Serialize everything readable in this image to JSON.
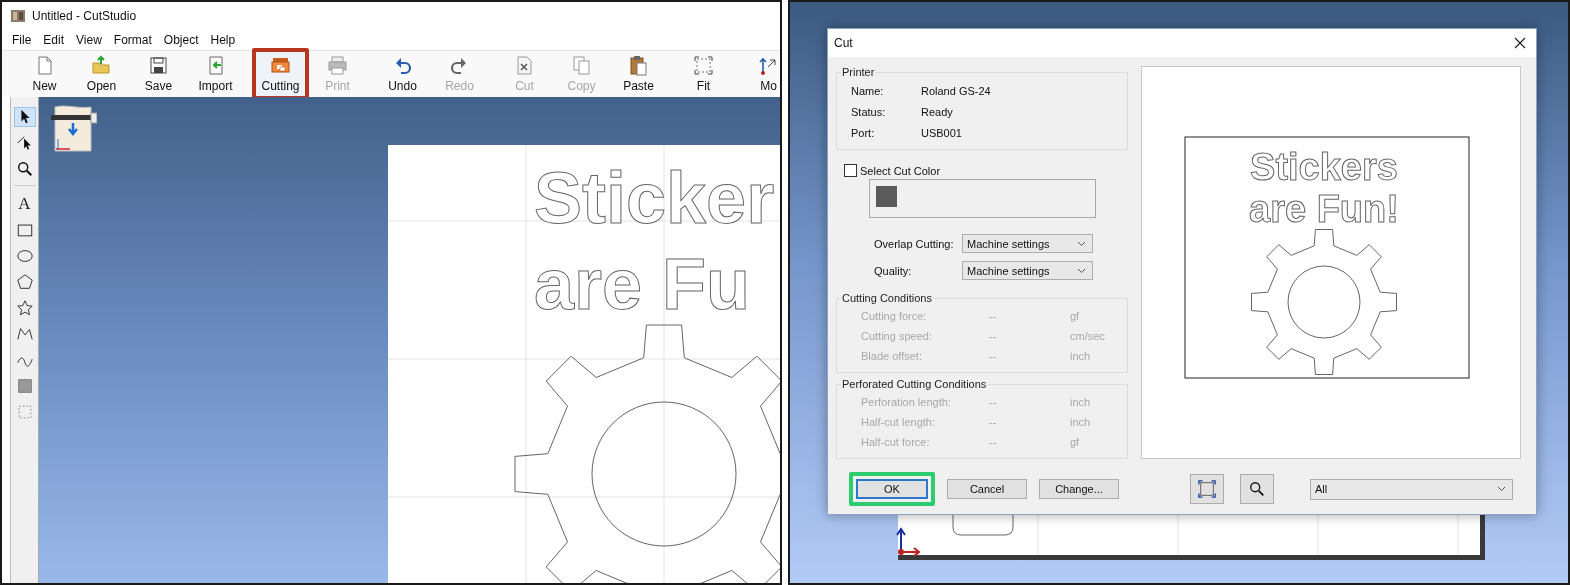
{
  "app_window": {
    "title": "Untitled - CutStudio",
    "menu": [
      "File",
      "Edit",
      "View",
      "Format",
      "Object",
      "Help"
    ],
    "toolbar_groups": [
      {
        "items": [
          {
            "kind": "new",
            "label": "New",
            "disabled": false,
            "highlighted": false
          },
          {
            "kind": "open",
            "label": "Open",
            "disabled": false,
            "highlighted": false
          },
          {
            "kind": "save",
            "label": "Save",
            "disabled": false,
            "highlighted": false
          },
          {
            "kind": "import",
            "label": "Import",
            "disabled": false,
            "highlighted": false
          }
        ]
      },
      {
        "items": [
          {
            "kind": "cutting",
            "label": "Cutting",
            "disabled": false,
            "highlighted": true
          },
          {
            "kind": "print",
            "label": "Print",
            "disabled": true,
            "highlighted": false
          }
        ]
      },
      {
        "items": [
          {
            "kind": "undo",
            "label": "Undo",
            "disabled": false,
            "highlighted": false
          },
          {
            "kind": "redo",
            "label": "Redo",
            "disabled": true,
            "highlighted": false
          }
        ]
      },
      {
        "items": [
          {
            "kind": "cut",
            "label": "Cut",
            "disabled": true,
            "highlighted": false
          },
          {
            "kind": "copy",
            "label": "Copy",
            "disabled": true,
            "highlighted": false
          },
          {
            "kind": "paste",
            "label": "Paste",
            "disabled": false,
            "highlighted": false
          }
        ]
      },
      {
        "items": [
          {
            "kind": "fit",
            "label": "Fit",
            "disabled": false,
            "highlighted": false
          }
        ]
      },
      {
        "items": [
          {
            "kind": "move",
            "label": "Mo",
            "disabled": false,
            "highlighted": false
          }
        ]
      }
    ],
    "tool_groups": [
      {
        "tools": [
          {
            "kind": "select",
            "selected": true
          },
          {
            "kind": "node",
            "selected": false
          },
          {
            "kind": "zoom",
            "selected": false
          }
        ]
      },
      {
        "tools": [
          {
            "kind": "text",
            "glyph": "A",
            "selected": false
          },
          {
            "kind": "rectangle",
            "selected": false
          },
          {
            "kind": "ellipse",
            "selected": false
          },
          {
            "kind": "polygon",
            "selected": false
          },
          {
            "kind": "star",
            "selected": false
          },
          {
            "kind": "polyline",
            "selected": false
          },
          {
            "kind": "curve",
            "selected": false
          },
          {
            "kind": "fill",
            "selected": false
          },
          {
            "kind": "frame",
            "selected": false
          }
        ]
      }
    ],
    "canvas": {
      "lines": [
        "Sticker",
        "are Fu"
      ]
    }
  },
  "cut_dialog": {
    "title": "Cut",
    "printer": {
      "legend": "Printer",
      "rows": [
        {
          "label": "Name:",
          "value": "Roland GS-24"
        },
        {
          "label": "Status:",
          "value": "Ready"
        },
        {
          "label": "Port:",
          "value": "USB001"
        }
      ]
    },
    "select_cut_color": {
      "label": "Select Cut Color",
      "checked": false
    },
    "cut_colors": [
      {
        "color": "#5a5a5a"
      }
    ],
    "options": [
      {
        "label": "Overlap Cutting:",
        "value": "Machine settings"
      },
      {
        "label": "Quality:",
        "value": "Machine settings"
      }
    ],
    "condition_groups": [
      {
        "legend": "Cutting Conditions",
        "disabled": true,
        "rows": [
          {
            "label": "Cutting force:",
            "value": "--",
            "unit": "gf"
          },
          {
            "label": "Cutting speed:",
            "value": "--",
            "unit": "cm/sec"
          },
          {
            "label": "Blade offset:",
            "value": "--",
            "unit": "inch"
          }
        ]
      },
      {
        "legend": "Perforated Cutting Conditions",
        "disabled": true,
        "rows": [
          {
            "label": "Perforation length:",
            "value": "--",
            "unit": "inch"
          },
          {
            "label": "Half-cut length:",
            "value": "--",
            "unit": "inch"
          },
          {
            "label": "Half-cut force:",
            "value": "--",
            "unit": "gf"
          }
        ]
      }
    ],
    "buttons": [
      {
        "label": "OK",
        "default": true,
        "highlighted": true
      },
      {
        "label": "Cancel",
        "default": false,
        "highlighted": false
      },
      {
        "label": "Change...",
        "default": false,
        "highlighted": false
      }
    ],
    "preview": {
      "lines": [
        "Stickers",
        "are Fun!"
      ]
    },
    "preview_tools": [
      {
        "kind": "fit"
      },
      {
        "kind": "zoom"
      }
    ],
    "range_select": {
      "value": "All"
    }
  }
}
